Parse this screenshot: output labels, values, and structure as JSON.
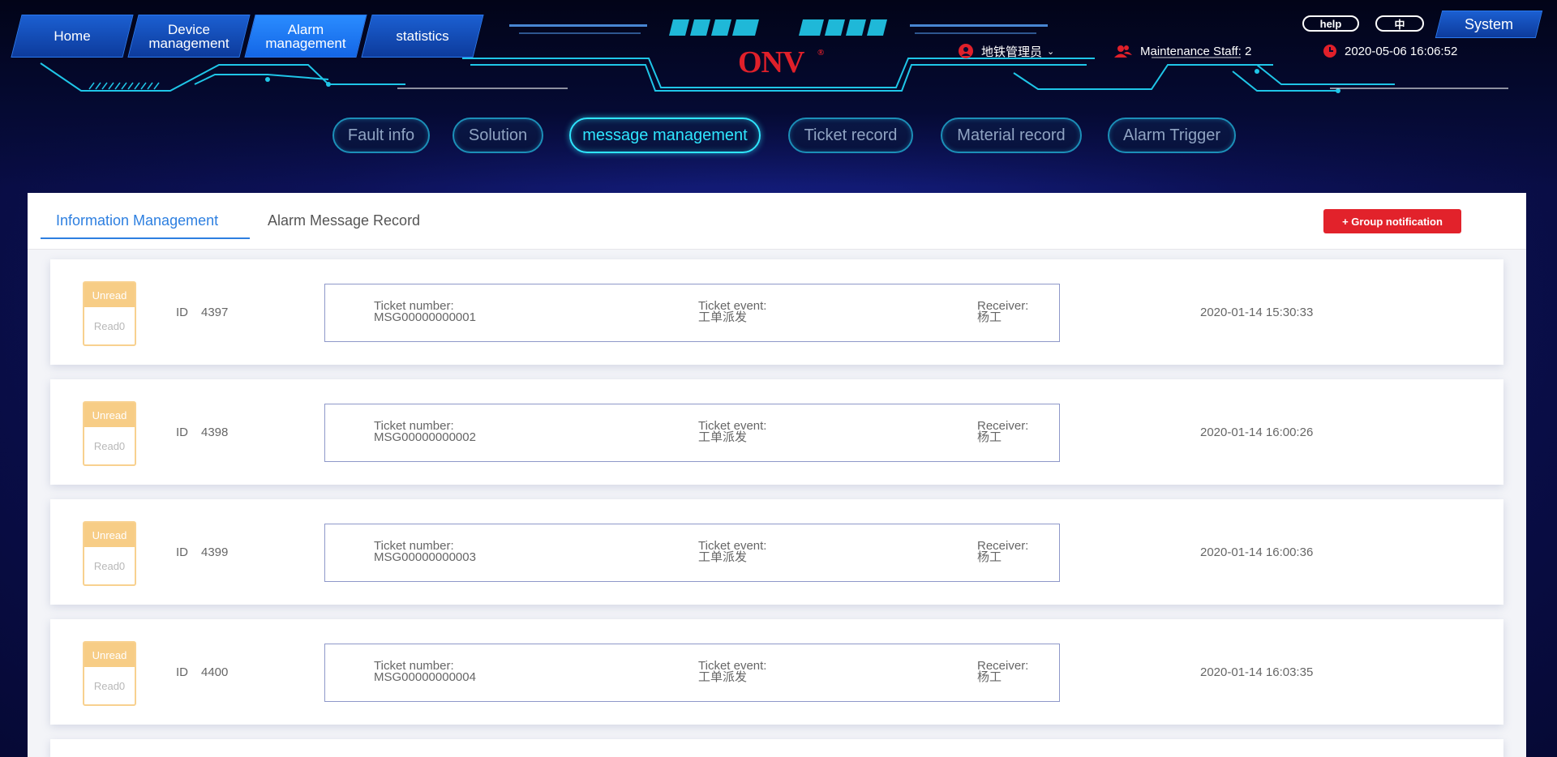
{
  "header": {
    "nav": [
      {
        "label": "Home"
      },
      {
        "label": "Device management"
      },
      {
        "label": "Alarm management"
      },
      {
        "label": "statistics"
      }
    ],
    "help_label": "help",
    "lang_label": "中",
    "system_label": "System",
    "logo_text": "ONV",
    "logo_mark": "®",
    "user_name": "地铁管理员",
    "maintenance": "Maintenance Staff: 2",
    "datetime": "2020-05-06 16:06:52",
    "colors": {
      "accent_cyan": "#2fe6ff",
      "nav_blue": "#1b5fd1",
      "alert_red": "#e0202a"
    }
  },
  "subtabs": [
    {
      "label": "Fault info"
    },
    {
      "label": "Solution"
    },
    {
      "label": "message management"
    },
    {
      "label": "Ticket record"
    },
    {
      "label": "Material record"
    },
    {
      "label": "Alarm Trigger"
    }
  ],
  "panel": {
    "tabs": [
      {
        "label": "Information Management"
      },
      {
        "label": "Alarm Message Record"
      }
    ],
    "group_button": "+ Group notification",
    "labels": {
      "unread": "Unread",
      "read": "Read0",
      "id": "ID",
      "ticket_number": "Ticket number:",
      "ticket_event": "Ticket event:",
      "receiver": "Receiver:"
    },
    "messages": [
      {
        "id": "4397",
        "ticket_number": "MSG00000000001",
        "event": "工单派发",
        "receiver": "杨工",
        "time": "2020-01-14 15:30:33"
      },
      {
        "id": "4398",
        "ticket_number": "MSG00000000002",
        "event": "工单派发",
        "receiver": "杨工",
        "time": "2020-01-14 16:00:26"
      },
      {
        "id": "4399",
        "ticket_number": "MSG00000000003",
        "event": "工单派发",
        "receiver": "杨工",
        "time": "2020-01-14 16:00:36"
      },
      {
        "id": "4400",
        "ticket_number": "MSG00000000004",
        "event": "工单派发",
        "receiver": "杨工",
        "time": "2020-01-14 16:03:35"
      }
    ]
  }
}
